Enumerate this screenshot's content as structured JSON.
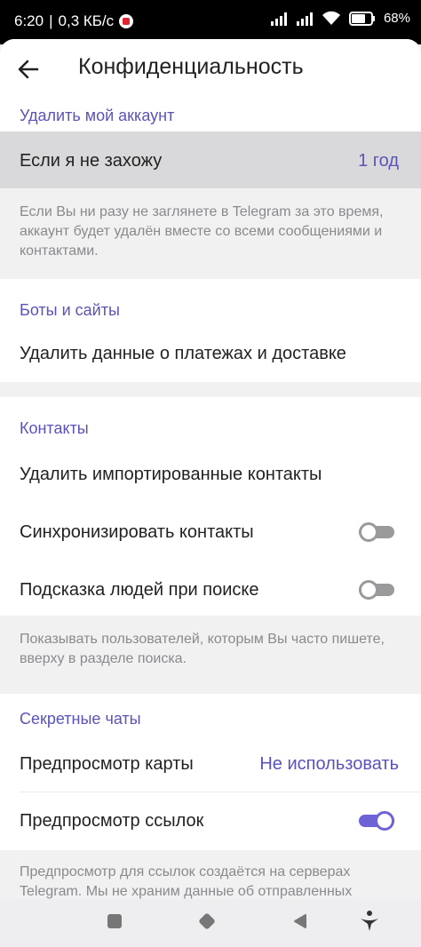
{
  "status_bar": {
    "time": "6:20",
    "speed": "0,3 КБ/с",
    "battery": "68"
  },
  "header": {
    "title": "Конфиденциальность",
    "back_icon": "arrow-back-icon"
  },
  "delete_account": {
    "section_title": "Удалить мой аккаунт",
    "row_label": "Если я не захожу",
    "row_value": "1 год",
    "hint": "Если Вы ни разу не заглянете в Telegram за это время, аккаунт будет удалён вместе со всеми сообщениями и контактами."
  },
  "bots": {
    "section_title": "Боты и сайты",
    "row_label": "Удалить данные о платежах и доставке"
  },
  "contacts": {
    "section_title": "Контакты",
    "delete_imported": "Удалить импортированные контакты",
    "sync_label": "Синхронизировать контакты",
    "sync_on": false,
    "suggest_label": "Подсказка людей при поиске",
    "suggest_on": false,
    "hint": "Показывать пользователей, которым Вы часто пишете, вверху в разделе поиска."
  },
  "secret_chats": {
    "section_title": "Секретные чаты",
    "map_label": "Предпросмотр карты",
    "map_value": "Не использовать",
    "links_label": "Предпросмотр ссылок",
    "links_on": true,
    "hint": "Предпросмотр для ссылок создаётся на серверах Telegram. Мы не храним данные об отправленных"
  },
  "colors": {
    "accent": "#5b54b8",
    "toggle_on": "#6e63d6",
    "toggle_off": "#9a9a9c"
  }
}
